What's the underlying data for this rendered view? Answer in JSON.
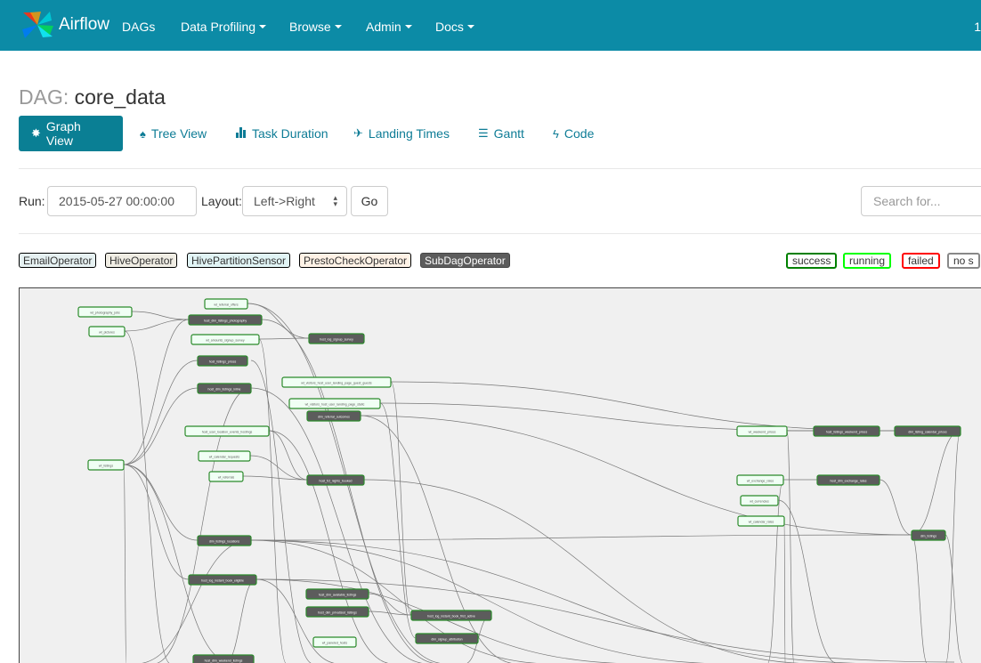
{
  "nav": {
    "brand": "Airflow",
    "items": [
      "DAGs",
      "Data Profiling",
      "Browse",
      "Admin",
      "Docs"
    ],
    "clock": "1"
  },
  "page": {
    "title_prefix": "DAG:",
    "dag_name": "core_data"
  },
  "tabs": [
    {
      "label": "Graph View",
      "icon": "asterisk-icon",
      "active": true
    },
    {
      "label": "Tree View",
      "icon": "tree-icon"
    },
    {
      "label": "Task Duration",
      "icon": "bar-chart-icon"
    },
    {
      "label": "Landing Times",
      "icon": "plane-icon"
    },
    {
      "label": "Gantt",
      "icon": "align-left-icon"
    },
    {
      "label": "Code",
      "icon": "flash-icon"
    }
  ],
  "form": {
    "run_label": "Run:",
    "run_value": "2015-05-27 00:00:00",
    "layout_label": "Layout:",
    "layout_value": "Left->Right",
    "go_label": "Go",
    "search_placeholder": "Search for..."
  },
  "operators": [
    {
      "label": "EmailOperator",
      "color": "#e6f1f2"
    },
    {
      "label": "HiveOperator",
      "color": "#f0ede4"
    },
    {
      "label": "HivePartitionSensor",
      "color": "#e1f4f5"
    },
    {
      "label": "PrestoCheckOperator",
      "color": "#fff2e6"
    },
    {
      "label": "SubDagOperator",
      "color": "#5c5c5c"
    }
  ],
  "states": [
    {
      "label": "success",
      "color": "#008000"
    },
    {
      "label": "running",
      "color": "#00ff00"
    },
    {
      "label": "failed",
      "color": "#ff0000"
    },
    {
      "label": "no s",
      "color": "#888888"
    }
  ],
  "graph": {
    "sensor_nodes": [
      "wt_photography_jobs",
      "wt_pictures",
      "wt_referral_offers",
      "wt_amounts_signup_survey",
      "wt_visitors_host_user_landing_page_guest_guests",
      "wt_visitors_host_user_landing_page_static",
      "host_user_location_events_hostings",
      "wt_calendar_requests",
      "wt_listings",
      "wt_referrals",
      "wt_weekend_prices",
      "wt_exchange_rates",
      "wt_currencies",
      "wt_calendar_rates",
      "wt_paneled_hosts"
    ],
    "subdag_nodes": [
      "host_dim_listings_photography",
      "host_log_signup_survey",
      "host_listings_prices",
      "host_dim_listings_inline",
      "dim_referral_outcomes",
      "host_fct_nights_booked",
      "dim_listings_locations",
      "host_log_instant_book_eligible",
      "host_dim_available_listings",
      "host_dim_privatized_listings",
      "host_log_instant_book_first_active",
      "dim_signup_attribution",
      "host_dim_weekend_listings",
      "host_listings_weekend_prices",
      "dim_listing_calendar_prices",
      "host_dim_exchange_rates",
      "dim_listings"
    ]
  }
}
